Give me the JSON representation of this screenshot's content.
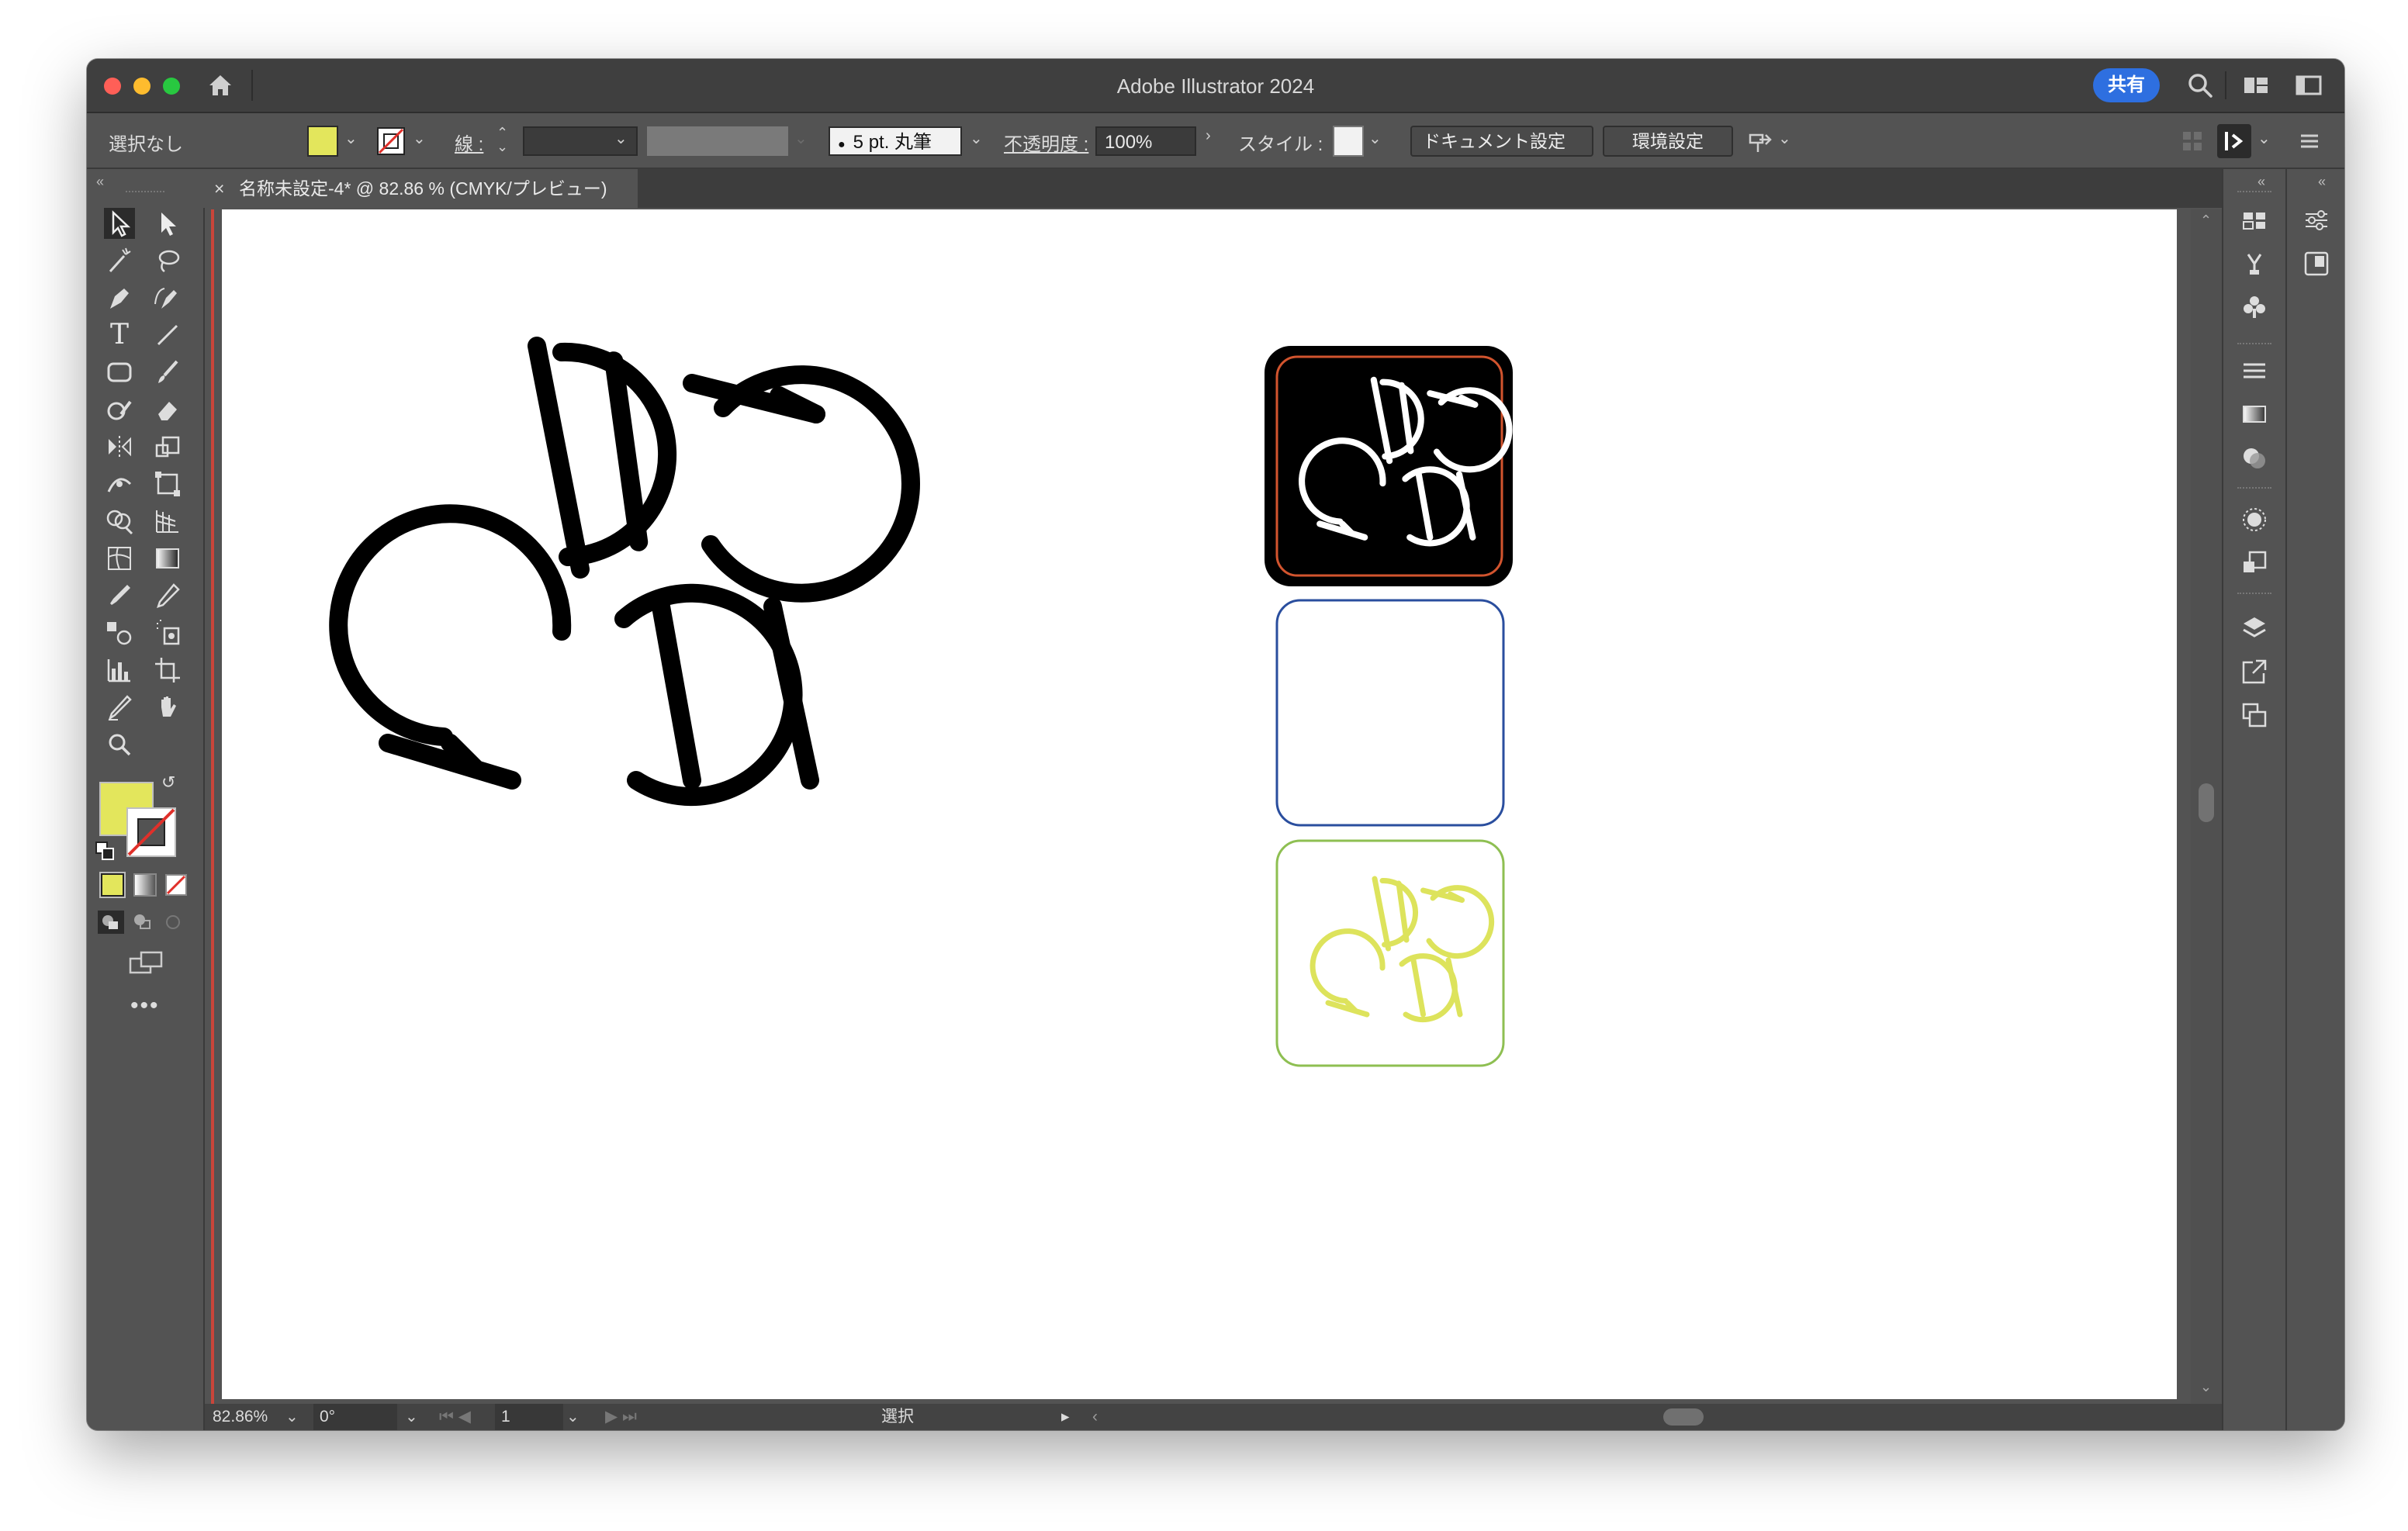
{
  "window": {
    "title": "Adobe Illustrator 2024",
    "share_label": "共有"
  },
  "control_bar": {
    "selection_label": "選択なし",
    "fill_color": "#e3e65c",
    "stroke_label": "線 :",
    "brush_label": "5 pt. 丸筆",
    "opacity_label": "不透明度 :",
    "opacity_value": "100%",
    "style_label": "スタイル :",
    "doc_setup_button": "ドキュメント設定",
    "preferences_button": "環境設定"
  },
  "document": {
    "tab_title": "名称未設定-4* @ 82.86 % (CMYK/プレビュー)",
    "close_glyph": "×"
  },
  "status_bar": {
    "zoom": "82.86%",
    "rotation": "0°",
    "artboard_number": "1",
    "tool_status": "選択"
  },
  "artwork": {
    "logo_stroke_color": "#000000",
    "card1_background": "#000000",
    "card1_border": "#d2542e",
    "card1_logo_color": "#ffffff",
    "card2_border": "#2a4e9e",
    "card3_border": "#8ebf52",
    "card3_logo_color": "#dde35c"
  },
  "icons": {
    "home": "home-icon",
    "search": "search-icon",
    "workspace": "workspace-icon",
    "panel_toggle": "panel-toggle-icon"
  }
}
